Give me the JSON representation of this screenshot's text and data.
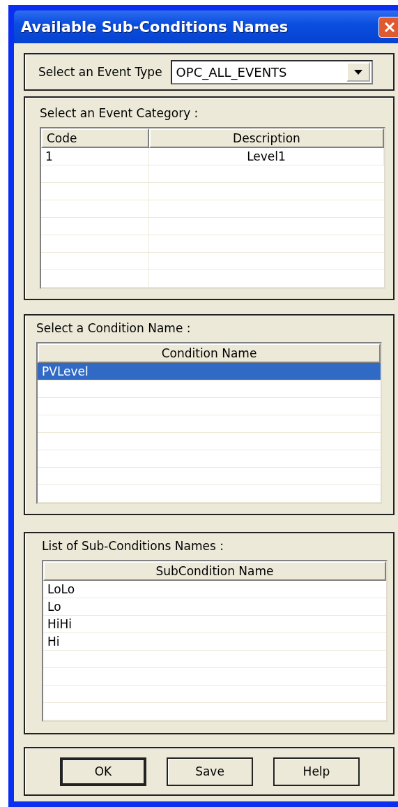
{
  "window": {
    "title": "Available Sub-Conditions Names"
  },
  "event_type": {
    "label": "Select an Event Type",
    "value": "OPC_ALL_EVENTS"
  },
  "event_category": {
    "label": "Select an Event Category  :",
    "table": {
      "columns": [
        "Code",
        "Description"
      ],
      "rows": [
        {
          "cells": [
            "1",
            "Level1"
          ],
          "selected": false
        }
      ]
    }
  },
  "condition_name": {
    "label": "Select a Condition Name :",
    "table": {
      "columns": [
        "Condition Name"
      ],
      "rows": [
        {
          "cells": [
            "PVLevel"
          ],
          "selected": true
        }
      ]
    }
  },
  "sub_conditions": {
    "label": "List of Sub-Conditions Names :",
    "table": {
      "columns": [
        "SubCondition Name"
      ],
      "rows": [
        {
          "cells": [
            "LoLo"
          ],
          "selected": false
        },
        {
          "cells": [
            "Lo"
          ],
          "selected": false
        },
        {
          "cells": [
            "HiHi"
          ],
          "selected": false
        },
        {
          "cells": [
            "Hi"
          ],
          "selected": false
        }
      ]
    }
  },
  "buttons": [
    {
      "label": "OK",
      "default": true
    },
    {
      "label": "Save",
      "default": false
    },
    {
      "label": "Help",
      "default": false
    }
  ]
}
